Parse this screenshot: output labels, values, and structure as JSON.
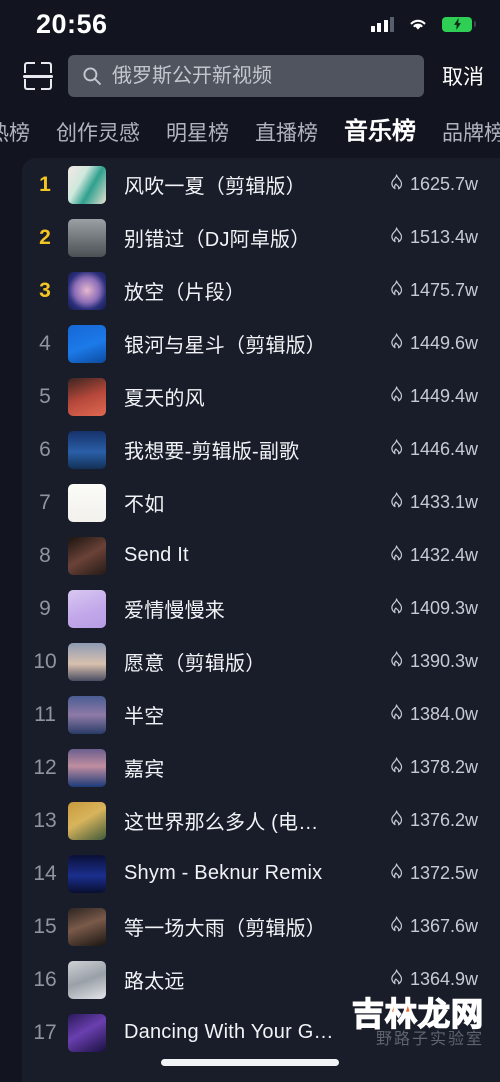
{
  "status_bar": {
    "time": "20:56",
    "signal_icon": "cellular-signal-icon",
    "wifi_icon": "wifi-icon",
    "battery_icon": "battery-charging-icon",
    "battery_color": "#2fce55"
  },
  "search": {
    "scan_icon": "scan-code-icon",
    "search_icon": "search-icon",
    "placeholder": "俄罗斯公开新视频",
    "value": "",
    "cancel_label": "取消"
  },
  "tabs": {
    "active_index": 4,
    "items": [
      {
        "label": "热榜"
      },
      {
        "label": "创作灵感"
      },
      {
        "label": "明星榜"
      },
      {
        "label": "直播榜"
      },
      {
        "label": "音乐榜"
      },
      {
        "label": "品牌榜"
      }
    ]
  },
  "list": {
    "heat_icon": "flame-icon",
    "top_rank_color": "#f3c623",
    "rows": [
      {
        "rank": "1",
        "title": "风吹一夏（剪辑版）",
        "heat": "1625.7w",
        "top": true,
        "thumb": "linear-gradient(120deg,#f3e9e4 0%,#cfe8dd 35%,#2fa08e 60%,#e8e2d2 100%)"
      },
      {
        "rank": "2",
        "title": "别错过（DJ阿卓版）",
        "heat": "1513.4w",
        "top": true,
        "thumb": "linear-gradient(180deg,#9aa0a4 0%,#6e7478 55%,#4b5053 100%)"
      },
      {
        "rank": "3",
        "title": "放空（片段）",
        "heat": "1475.7w",
        "top": true,
        "thumb": "radial-gradient(circle at 50% 48%,#e7b7cf 0%,#8d6fb8 45%,#2a2f7a 70%,#161a4a 100%)"
      },
      {
        "rank": "4",
        "title": "银河与星斗（剪辑版）",
        "heat": "1449.6w",
        "top": false,
        "thumb": "linear-gradient(160deg,#1667d6 0%,#1c7ae8 55%,#0c4aa0 100%)"
      },
      {
        "rank": "5",
        "title": "夏天的风",
        "heat": "1449.4w",
        "top": false,
        "thumb": "linear-gradient(160deg,#3a2520 0%,#b5473a 50%,#e06a52 100%)"
      },
      {
        "rank": "6",
        "title": "我想要-剪辑版-副歌",
        "heat": "1446.4w",
        "top": false,
        "thumb": "linear-gradient(180deg,#16326b 0%,#2a5fa8 55%,#123055 100%)"
      },
      {
        "rank": "7",
        "title": "不如",
        "heat": "1433.1w",
        "top": false,
        "thumb": "linear-gradient(180deg,#fbfbf8 0%,#f2f1ec 100%)"
      },
      {
        "rank": "8",
        "title": "Send It",
        "heat": "1432.4w",
        "top": false,
        "thumb": "linear-gradient(150deg,#1a1410 0%,#6b4238 50%,#241a16 100%)"
      },
      {
        "rank": "9",
        "title": "爱情慢慢来",
        "heat": "1409.3w",
        "top": false,
        "thumb": "linear-gradient(160deg,#d9c8f2 0%,#c3a9ea 55%,#b79ce4 100%)"
      },
      {
        "rank": "10",
        "title": "愿意（剪辑版）",
        "heat": "1390.3w",
        "top": false,
        "thumb": "linear-gradient(180deg,#8e9bb4 0%,#d8c0ae 55%,#4a4d63 100%)"
      },
      {
        "rank": "11",
        "title": "半空",
        "heat": "1384.0w",
        "top": false,
        "thumb": "linear-gradient(180deg,#4a5d92 0%,#8f7aa8 50%,#2a3c66 100%)"
      },
      {
        "rank": "12",
        "title": "嘉宾",
        "heat": "1378.2w",
        "top": false,
        "thumb": "linear-gradient(180deg,#6b5f8e 0%,#c08ea0 45%,#1c3a78 100%)"
      },
      {
        "rank": "13",
        "title": "这世界那么多人 (电…",
        "heat": "1376.2w",
        "top": false,
        "thumb": "linear-gradient(150deg,#c89a3e 0%,#d8b45c 45%,#3f5a3a 100%)"
      },
      {
        "rank": "14",
        "title": "Shym - Beknur Remix",
        "heat": "1372.5w",
        "top": false,
        "thumb": "linear-gradient(180deg,#0b1038 0%,#1b2f8e 55%,#0a0f30 100%)"
      },
      {
        "rank": "15",
        "title": "等一场大雨（剪辑版）",
        "heat": "1367.6w",
        "top": false,
        "thumb": "linear-gradient(160deg,#2b2420 0%,#7a5a4a 45%,#1a1512 100%)"
      },
      {
        "rank": "16",
        "title": "路太远",
        "heat": "1364.9w",
        "top": false,
        "thumb": "linear-gradient(160deg,#cfd2d6 0%,#9aa0a8 50%,#e3e5e8 100%)"
      },
      {
        "rank": "17",
        "title": "Dancing With Your G…",
        "heat": "",
        "top": false,
        "thumb": "linear-gradient(150deg,#2a1a5a 0%,#6a3fb0 45%,#1a1040 100%)"
      }
    ]
  },
  "watermark": {
    "main": "吉林龙网",
    "sub": "野路子实验室",
    "color": "#f0692a"
  }
}
